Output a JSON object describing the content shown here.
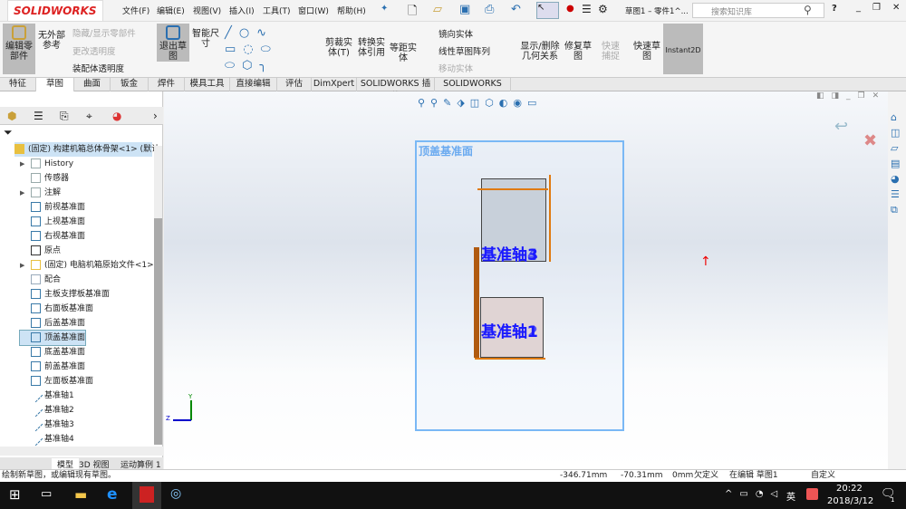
{
  "app": {
    "logo": "SOLIDWORKS",
    "doc_title": "草图1 – 零件1^...",
    "search_placeholder": "搜索知识库"
  },
  "menu": [
    "文件(F)",
    "编辑(E)",
    "视图(V)",
    "插入(I)",
    "工具(T)",
    "窗口(W)",
    "帮助(H)"
  ],
  "ribbon": {
    "edit_part": "编辑零部件",
    "no_ext_ref": "无外部参考",
    "hide_show": "隐藏/显示零部件",
    "change_transparency": "更改透明度",
    "assembly_transparency": "装配体透明度",
    "exit_sketch": "退出草图",
    "smart_dim": "智能尺寸",
    "trim": "剪裁实体(T)",
    "convert": "转换实体引用",
    "offset": "等距实体",
    "mirror": "镜向实体",
    "linear_pattern": "线性草图阵列",
    "move": "移动实体",
    "relations": "显示/删除几何关系",
    "repair": "修复草图",
    "quick_snap": "快速捕捉",
    "rapid_sketch": "快速草图",
    "instant2d": "Instant2D"
  },
  "tabs": [
    "特征",
    "草图",
    "曲面",
    "钣金",
    "焊件",
    "模具工具",
    "直接编辑",
    "评估",
    "DimXpert",
    "SOLIDWORKS 插件",
    "SOLIDWORKS MBD"
  ],
  "tree": {
    "root": "(固定) 构建机箱总体骨架<1> (默认",
    "items": [
      "History",
      "传感器",
      "注解",
      "前视基准面",
      "上视基准面",
      "右视基准面",
      "原点",
      "(固定) 电脑机箱原始文件<1>",
      "配合",
      "主板支撑板基准面",
      "右面板基准面",
      "后盖基准面",
      "顶盖基准面",
      "底盖基准面",
      "前盖基准面",
      "左面板基准面",
      "基准轴1",
      "基准轴2",
      "基准轴3",
      "基准轴4"
    ]
  },
  "bottom_tabs": [
    "模型",
    "3D 视图",
    "运动算例 1"
  ],
  "canvas": {
    "plane_label": "顶盖基准面",
    "axis_top_a": "基准轴3",
    "axis_top_b": "基准轴4",
    "axis_bot_a": "基准轴1",
    "axis_bot_b": "基准轴2",
    "triad_y": "Y",
    "triad_z": "Z"
  },
  "status": {
    "message": "绘制新草图，或编辑现有草图。",
    "x": "-346.71mm",
    "y": "-70.31mm",
    "z": "0mm",
    "state": "欠定义",
    "mode": "在编辑 草图1",
    "units": "自定义"
  },
  "taskbar": {
    "time": "20:22",
    "date": "2018/3/12",
    "ime": "英",
    "notif": "1"
  }
}
